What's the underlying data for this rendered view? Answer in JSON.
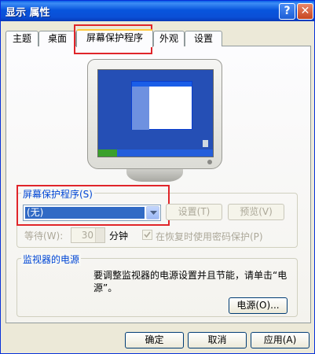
{
  "window": {
    "title": "显示 属性",
    "help_glyph": "?",
    "close_glyph": "✕"
  },
  "tabs": [
    "主题",
    "桌面",
    "屏幕保护程序",
    "外观",
    "设置"
  ],
  "active_tab_index": 2,
  "screensaver_group": {
    "legend": "屏幕保护程序(S)",
    "selected_value": "(无)",
    "settings_button": "设置(T)",
    "preview_button": "预览(V)",
    "wait_label": "等待(W):",
    "wait_value": "30",
    "minutes_label": "分钟",
    "password_checkbox_label": "在恢复时使用密码保护(P)",
    "password_checked": true
  },
  "power_group": {
    "legend": "监视器的电源",
    "description_line1": "要调整监视器的电源设置并且节能，请单击“电",
    "description_line2": "源”。",
    "power_button": "电源(O)..."
  },
  "footer": {
    "ok": "确定",
    "cancel": "取消",
    "apply": "应用(A)"
  },
  "colors": {
    "highlight": "#e0252a",
    "title_blue": "#0a5fe8",
    "selection": "#316ac5"
  }
}
